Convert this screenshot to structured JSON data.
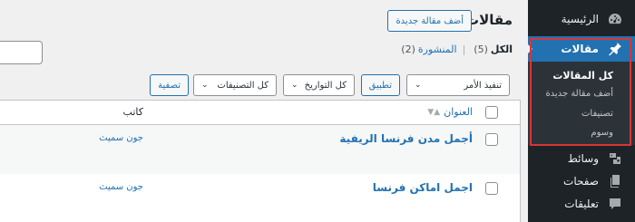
{
  "sidebar": {
    "home_label": "الرئيسية",
    "posts_label": "مقالات",
    "submenu": [
      "كل المقالات",
      "أضف مقالة جديدة",
      "تصنيفات",
      "وسوم"
    ],
    "media_label": "وسائط",
    "pages_label": "صفحات",
    "comments_label": "تعليقات",
    "accent_color": "#2271b1",
    "highlight_color": "#d63638"
  },
  "header": {
    "title": "مقالات",
    "add_new_label": "أضف مقالة جديدة"
  },
  "filters_nav": {
    "all_label": "الكل",
    "all_count": "(5)",
    "published_label": "المنشورة",
    "published_count": "(2)"
  },
  "toolbar": {
    "bulk_action_selected": "تنفيذ الأمر",
    "apply_label": "تطبيق",
    "dates_selected": "كل التواريخ",
    "categories_selected": "كل التصنيفات",
    "filter_label": "تصفية"
  },
  "table": {
    "columns": {
      "title": "العنوان",
      "author": "كاتب"
    },
    "rows": [
      {
        "title": "أجمل مدن فرنسا الريفية",
        "author": "جون سميث"
      },
      {
        "title": "اجمل اماكن فرنسا",
        "author": "جون سميث"
      }
    ]
  }
}
